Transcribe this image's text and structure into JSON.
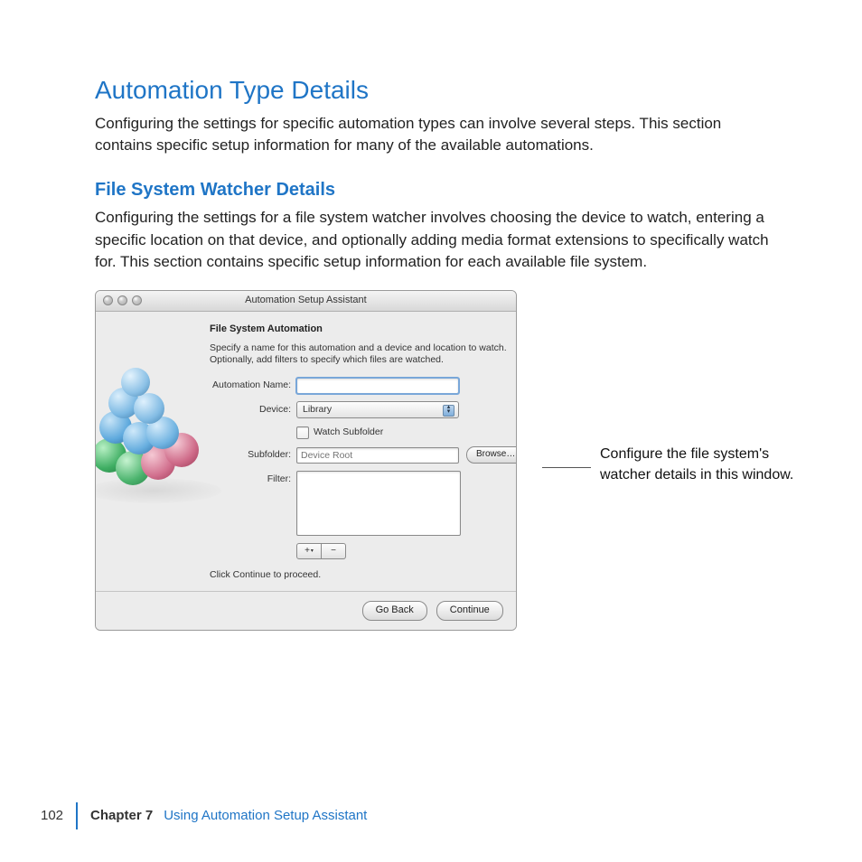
{
  "section": {
    "title": "Automation Type Details",
    "intro": "Configuring the settings for specific automation types can involve several steps. This section contains specific setup information for many of the available automations."
  },
  "subsection": {
    "title": "File System Watcher Details",
    "intro": "Configuring the settings for a file system watcher involves choosing the device to watch, entering a specific location on that device, and optionally adding media format extensions to specifically watch for. This section contains specific setup information for each available file system."
  },
  "window": {
    "title": "Automation Setup Assistant",
    "panel_title": "File System Automation",
    "instructions": "Specify a name for this automation and a device and location to watch. Optionally, add filters to specify which files are watched.",
    "labels": {
      "automation_name": "Automation Name:",
      "device": "Device:",
      "watch_subfolder": "Watch Subfolder",
      "subfolder": "Subfolder:",
      "filter": "Filter:"
    },
    "values": {
      "automation_name": "",
      "device": "Library",
      "subfolder_placeholder": "Device Root"
    },
    "buttons": {
      "browse": "Browse…",
      "add": "+",
      "remove": "−",
      "go_back": "Go Back",
      "continue": "Continue"
    },
    "continue_hint": "Click Continue to proceed."
  },
  "callout": "Configure the file system's watcher details in this window.",
  "footer": {
    "page": "102",
    "chapter_label": "Chapter 7",
    "chapter_title": "Using Automation Setup Assistant"
  }
}
